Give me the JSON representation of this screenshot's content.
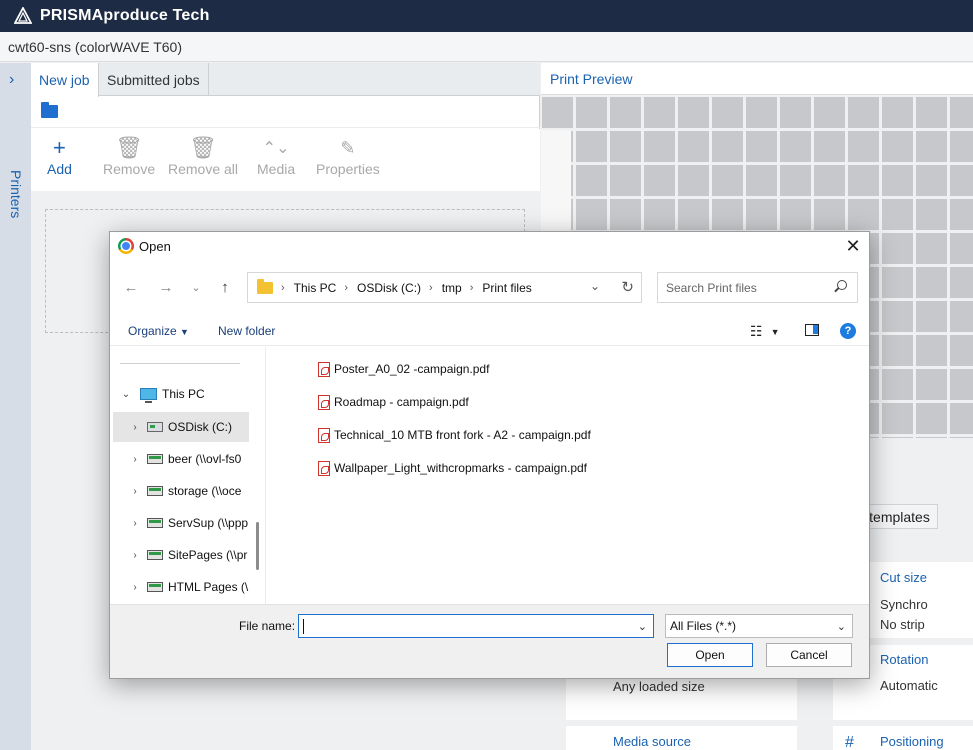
{
  "app": {
    "title": "PRISMAproduce Tech",
    "printer": "cwt60-sns (colorWAVE T60)"
  },
  "side": {
    "label": "Printers"
  },
  "tabs": [
    {
      "label": "New job"
    },
    {
      "label": "Submitted jobs"
    }
  ],
  "toolbar": {
    "add": "Add",
    "remove": "Remove",
    "remove_all": "Remove all",
    "media": "Media",
    "properties": "Properties"
  },
  "preview": {
    "title": "Print Preview",
    "templates": "templates"
  },
  "cards": {
    "cut_size": {
      "title": "Cut size",
      "value1": "Synchro",
      "value2": "No strip"
    },
    "rotation": {
      "title": "Rotation",
      "value": "Automatic"
    },
    "media_size": {
      "value": "Any loaded size"
    },
    "media_source": {
      "title": "Media source"
    },
    "positioning": {
      "title": "Positioning"
    }
  },
  "dialog": {
    "title": "Open",
    "path": [
      "This PC",
      "OSDisk (C:)",
      "tmp",
      "Print files"
    ],
    "search_placeholder": "Search Print files",
    "organize": "Organize",
    "new_folder": "New folder",
    "help": "?",
    "tree": [
      {
        "label": "This PC",
        "icon": "pc-icon",
        "expanded": true
      },
      {
        "label": "OSDisk (C:)",
        "icon": "drive-icon",
        "selected": true
      },
      {
        "label": "beer (\\\\ovl-fs0",
        "icon": "network-drive-icon"
      },
      {
        "label": "storage (\\\\oce",
        "icon": "network-drive-icon"
      },
      {
        "label": "ServSup (\\\\ppp",
        "icon": "network-drive-icon"
      },
      {
        "label": "SitePages (\\\\pr",
        "icon": "network-drive-icon"
      },
      {
        "label": "HTML Pages (\\",
        "icon": "network-drive-icon"
      }
    ],
    "files": [
      {
        "name": "Poster_A0_02 -campaign.pdf"
      },
      {
        "name": "Roadmap - campaign.pdf"
      },
      {
        "name": "Technical_10 MTB front fork - A2 - campaign.pdf"
      },
      {
        "name": "Wallpaper_Light_withcropmarks - campaign.pdf"
      }
    ],
    "file_name_label": "File name:",
    "file_name_value": "",
    "file_type": "All Files (*.*)",
    "open_button": "Open",
    "cancel_button": "Cancel"
  },
  "colors": {
    "header_bg": "#1d2b44",
    "accent": "#1b62b0"
  }
}
